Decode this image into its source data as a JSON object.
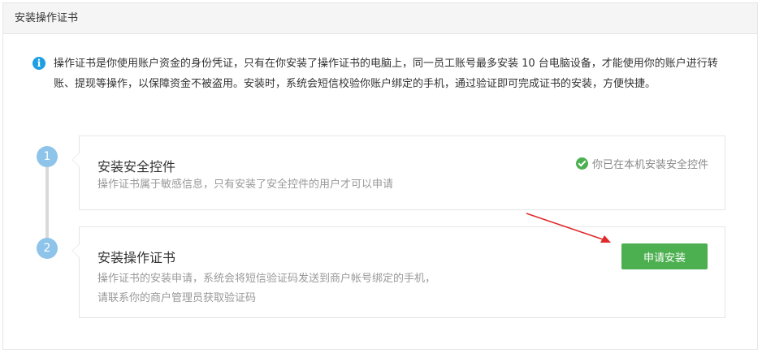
{
  "header": {
    "title": "安装操作证书"
  },
  "notice": {
    "text": "操作证书是你使用账户资金的身份凭证，只有在你安装了操作证书的电脑上，同一员工账号最多安装 10 台电脑设备，才能使用你的账户进行转账、提现等操作，以保障资金不被盗用。安装时，系统会短信校验你账户绑定的手机，通过验证即可完成证书的安装，方便快捷。"
  },
  "steps": [
    {
      "number": "1",
      "title": "安装安全控件",
      "desc_lines": [
        "操作证书属于敏感信息，只有安装了安全控件的用户才可以申请"
      ],
      "status": "你已在本机安装安全控件"
    },
    {
      "number": "2",
      "title": "安装操作证书",
      "desc_lines": [
        "操作证书的安装申请，系统会将短信验证码发送到商户帐号绑定的手机，",
        "请联系你的商户管理员获取验证码"
      ],
      "button_label": "申请安装"
    }
  ],
  "colors": {
    "accent_green": "#4cb050",
    "info_blue": "#1e9fe2",
    "step_blue": "#8ec4ea",
    "annotation_red": "#e02a2a"
  }
}
